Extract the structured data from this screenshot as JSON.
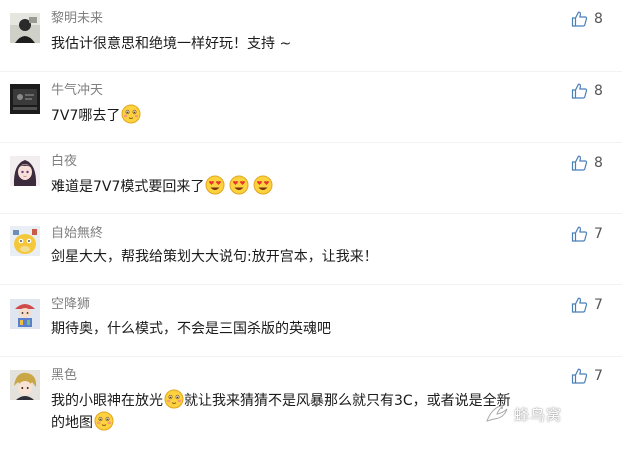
{
  "comments": [
    {
      "username": "黎明未来",
      "text_parts": [
        "我估计很意思和绝境一样好玩！支持 ~"
      ],
      "likes": "8",
      "avatar_icon": "dark-figure-avatar"
    },
    {
      "username": "牛气冲天",
      "text_parts": [
        "7V7哪去了"
      ],
      "likes": "8",
      "avatar_icon": "dark-game-avatar"
    },
    {
      "username": "白夜",
      "text_parts": [
        "难道是7V7模式要回来了"
      ],
      "likes": "8",
      "avatar_icon": "anime-girl-avatar"
    },
    {
      "username": "自始無終",
      "text_parts": [
        "剑星大大，帮我给策划大大说句:放开宫本，让我来！"
      ],
      "likes": "7",
      "avatar_icon": "psyduck-avatar"
    },
    {
      "username": "空降狮",
      "text_parts": [
        "期待奥，什么模式，不会是三国杀版的英魂吧"
      ],
      "likes": "7",
      "avatar_icon": "colorful-character-avatar"
    },
    {
      "username": "黑色",
      "text_parts": [
        "我的小眼神在放光",
        "就让我来猜猜不是风暴那么就只有3C，或者说是全新",
        "的地图"
      ],
      "likes": "7",
      "avatar_icon": "anime-boy-avatar"
    }
  ],
  "icons": {
    "like": "thumbs-up-icon",
    "emoji_blush": "blushing-emoji-icon",
    "emoji_heart_eyes": "heart-eyes-emoji-icon"
  },
  "watermark": {
    "text": "蜂鸟窝"
  },
  "colors": {
    "username": "#808080",
    "text": "#1a1a1a",
    "like_icon": "#4a7fb8",
    "like_count": "#555555"
  }
}
